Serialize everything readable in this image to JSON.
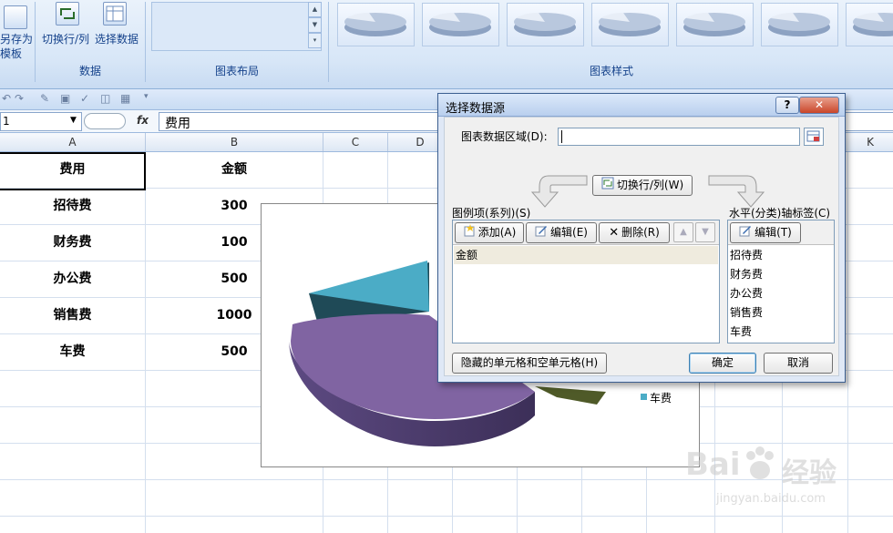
{
  "ribbon": {
    "partial_btn_label_line1": "另存为",
    "partial_btn_label_line2": "模板",
    "switch_row_col_label": "切换行/列",
    "select_data_label": "选择数据",
    "group_data_label": "数据",
    "group_layout_label": "图表布局",
    "group_styles_label": "图表样式"
  },
  "formula_bar": {
    "namebox_value": "1",
    "fx_label": "fx",
    "value": "费用"
  },
  "columns": [
    "A",
    "B",
    "C",
    "D",
    "K"
  ],
  "sheet": {
    "header": {
      "a": "费用",
      "b": "金额"
    },
    "rows": [
      {
        "a": "招待费",
        "b": "300"
      },
      {
        "a": "财务费",
        "b": "100"
      },
      {
        "a": "办公费",
        "b": "500"
      },
      {
        "a": "销售费",
        "b": "1000"
      },
      {
        "a": "车费",
        "b": "500"
      }
    ]
  },
  "chart": {
    "visible_legend_entry": "车费",
    "colors": {
      "slice_teal": "#4bacc6",
      "slice_purple": "#8064a2",
      "slice_olive": "#4f5a28",
      "legend_bullet": "#4bacc6"
    }
  },
  "dialog": {
    "title": "选择数据源",
    "help_button": "?",
    "close_button": "✕",
    "range_label": "图表数据区域(D):",
    "range_value": "",
    "switch_button": "切换行/列(W)",
    "series_label": "图例项(系列)(S)",
    "add_button": "添加(A)",
    "edit_button": "编辑(E)",
    "delete_button": "删除(R)",
    "series": [
      "金额"
    ],
    "axis_label": "水平(分类)轴标签(C)",
    "axis_edit_button": "编辑(T)",
    "categories": [
      "招待费",
      "财务费",
      "办公费",
      "销售费",
      "车费"
    ],
    "hidden_cells_button": "隐藏的单元格和空单元格(H)",
    "ok_button": "确定",
    "cancel_button": "取消"
  },
  "watermark": {
    "brand": "Bai",
    "brand_suffix": "经验",
    "url": "jingyan.baidu.com"
  }
}
